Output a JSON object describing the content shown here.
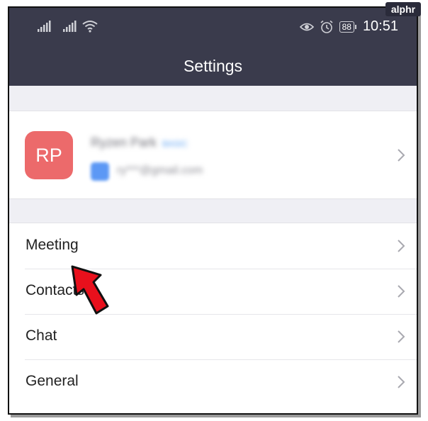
{
  "status_bar": {
    "battery": "88",
    "time": "10:51"
  },
  "header": {
    "title": "Settings"
  },
  "profile": {
    "initials": "RP",
    "name": "Ryzen Park",
    "badge": "BASIC",
    "email": "ry***@gmail.com"
  },
  "menu": [
    {
      "label": "Meeting"
    },
    {
      "label": "Contacts"
    },
    {
      "label": "Chat"
    },
    {
      "label": "General"
    }
  ],
  "watermark": "alphr",
  "colors": {
    "header_bg": "#3a3b4c",
    "avatar_bg": "#ec6a6b",
    "arrow": "#e8101c",
    "page_bg": "#efeff4"
  }
}
